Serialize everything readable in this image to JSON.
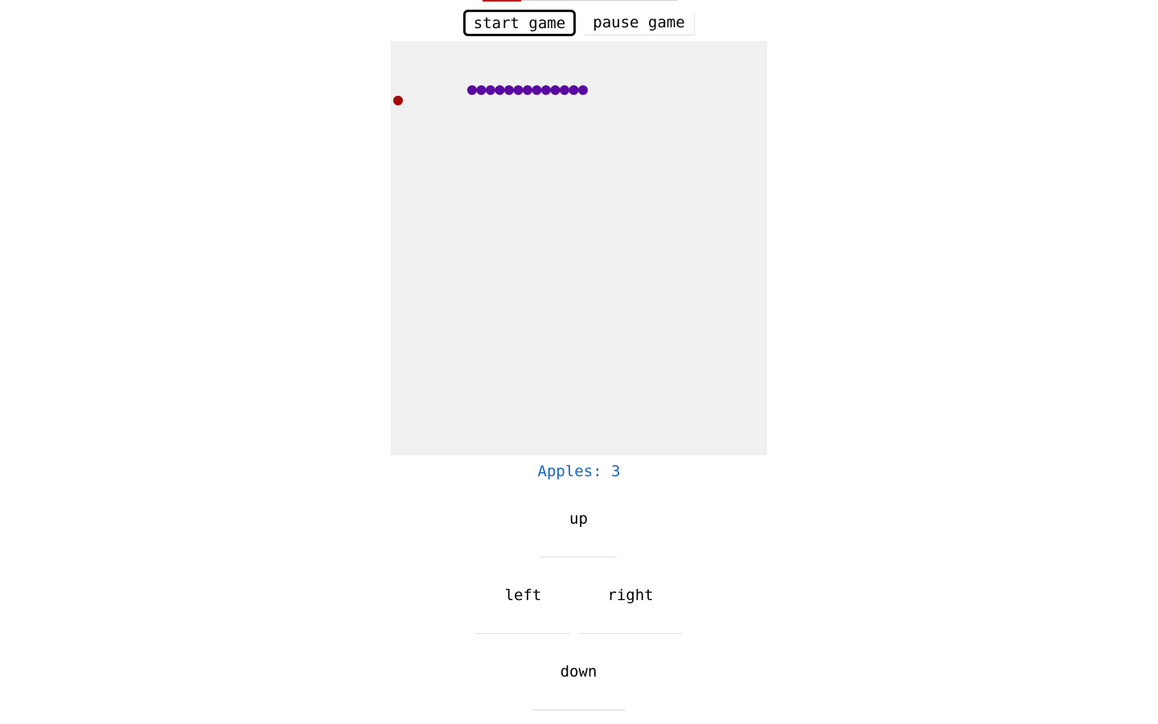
{
  "controls": {
    "start_label": "start game",
    "pause_label": "pause game"
  },
  "board": {
    "background": "#f0f0f0",
    "snake_color": "#5a0aa0",
    "apple_color": "#a10b0b",
    "snake_length": 13,
    "apple_count": 1
  },
  "score": {
    "label": "Apples: 3"
  },
  "dpad": {
    "up": "up",
    "left": "left",
    "right": "right",
    "down": "down"
  }
}
